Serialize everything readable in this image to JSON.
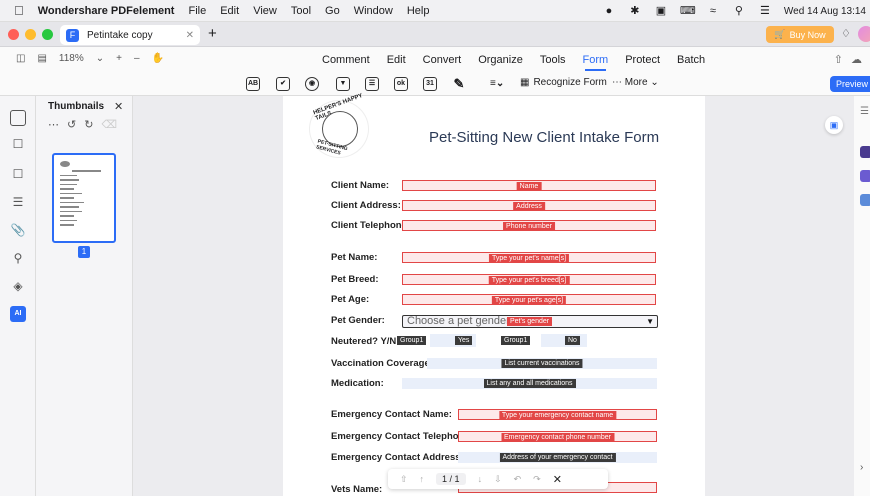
{
  "menubar": {
    "app_name": "Wondershare PDFelement",
    "items": [
      "File",
      "Edit",
      "View",
      "Tool",
      "Go",
      "Window",
      "Help"
    ],
    "datetime": "Wed 14 Aug  13:14"
  },
  "tabbar": {
    "doc_tab": "Petintake copy",
    "buy_label": "Buy Now"
  },
  "toolbar": {
    "zoom": "118%",
    "tabs": [
      "Comment",
      "Edit",
      "Convert",
      "Organize",
      "Tools",
      "Form",
      "Protect",
      "Batch"
    ],
    "active_tab": "Form",
    "recognize_form": "Recognize Form",
    "more": "More",
    "preview": "Preview",
    "field_tools": [
      "AB",
      "✔",
      "◉",
      "▼",
      "☰",
      "ok",
      "31",
      "✎"
    ]
  },
  "thumbnails": {
    "title": "Thumbnails",
    "page_number": "1"
  },
  "form": {
    "logo_top": "HELPER'S HAPPY TAILS",
    "logo_bottom": "PET-SITTING SERVICES",
    "title": "Pet-Sitting New Client Intake Form",
    "rows": [
      {
        "label": "Client Name:",
        "field": "Name"
      },
      {
        "label": "Client Address:",
        "field": "Address"
      },
      {
        "label": "Client Telephone:",
        "field": "Phone number"
      },
      {
        "label": "Pet Name:",
        "field": "Type your pet's name[s]"
      },
      {
        "label": "Pet Breed:",
        "field": "Type your pet's breed[s]"
      },
      {
        "label": "Pet Age:",
        "field": "Type your pet's age[s]"
      },
      {
        "label": "Pet Gender:",
        "field": "Pet's gender"
      },
      {
        "label": "Neutered? Y/N",
        "field": ""
      },
      {
        "label": "Vaccination Coverage:",
        "field": "List current vaccinations"
      },
      {
        "label": "Medication:",
        "field": "List any and all medications"
      },
      {
        "label": "Emergency Contact Name:",
        "field": "Type your emergency contact name"
      },
      {
        "label": "Emergency Contact Telephone:",
        "field": "Emergency contact phone number"
      },
      {
        "label": "Emergency Contact Address:",
        "field": "Address of your emergency contact"
      },
      {
        "label": "Vets Name:",
        "field": ""
      }
    ],
    "gender_placeholder": "Choose a pet gender",
    "radio_group": "Group1",
    "radio_yes": "Yes",
    "radio_no": "No"
  },
  "pagenav": {
    "page": "1  /  1"
  }
}
